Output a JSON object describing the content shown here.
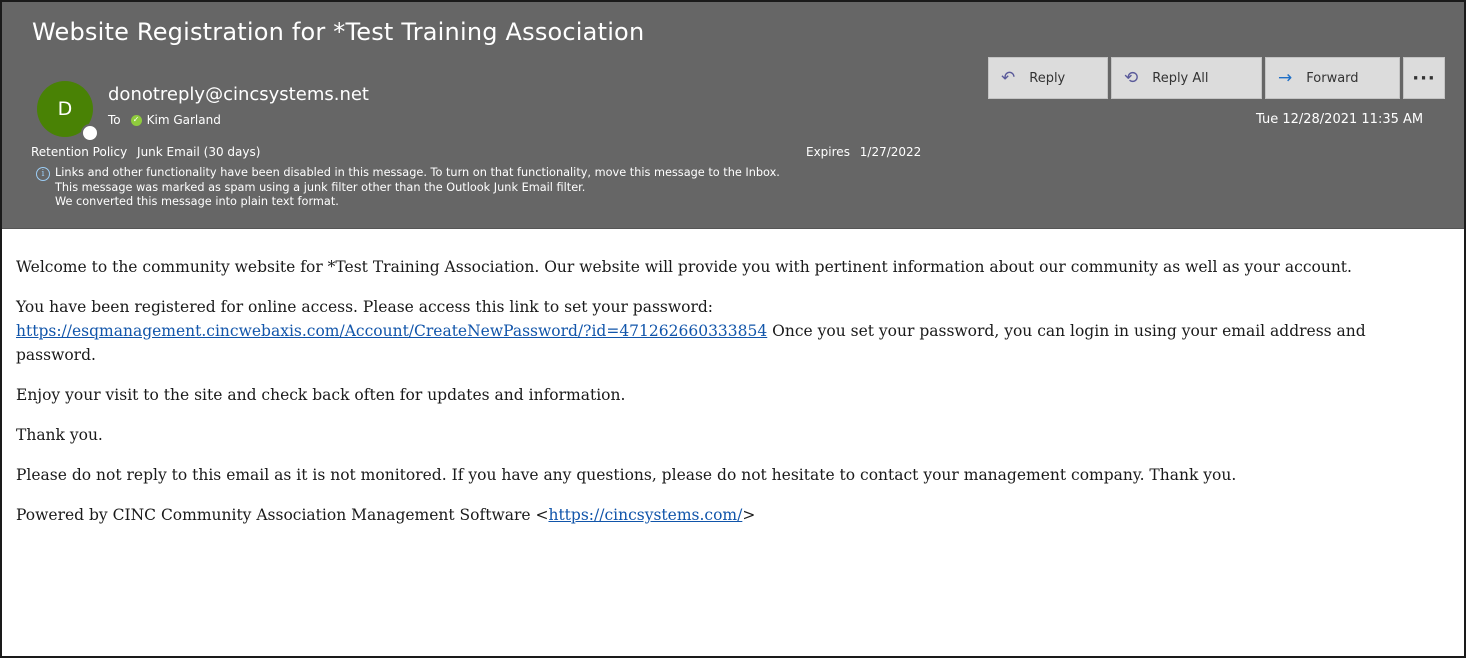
{
  "header": {
    "subject": "Website Registration for *Test Training Association",
    "avatar_initial": "D",
    "sender": "donotreply@cincsystems.net",
    "to_label": "To",
    "recipient": "Kim Garland",
    "retention_label": "Retention Policy",
    "retention_value": "Junk Email (30 days)",
    "expires_label": "Expires",
    "expires_value": "1/27/2022",
    "datetime": "Tue 12/28/2021 11:35 AM",
    "info_lines": [
      "Links and other functionality have been disabled in this message. To turn on that functionality, move this message to the Inbox.",
      "This message was marked as spam using a junk filter other than the Outlook Junk Email filter.",
      "We converted this message into plain text format."
    ],
    "avatar_color": "#498205",
    "header_bg": "#666666"
  },
  "actions": {
    "reply": "Reply",
    "reply_all": "Reply All",
    "forward": "Forward",
    "more": "···"
  },
  "body": {
    "p1": "Welcome to the community website for *Test Training Association. Our website will provide you with pertinent information about our community as well as your account.",
    "p2_text": "You have been registered for online access. Please access this link to set your password:",
    "p2_link": "https://esqmanagement.cincwebaxis.com/Account/CreateNewPassword/?id=471262660333854",
    "p2_after": " Once you set your password, you can login in using your email address and password.",
    "p3": "Enjoy your visit to the site and check back often for updates and information.",
    "p4": "Thank you.",
    "p5": "Please do not reply to this email as it is not monitored. If you have any questions, please do not hesitate to contact your management company. Thank you.",
    "p6_before": "Powered by CINC Community Association Management Software <",
    "p6_link": "https://cincsystems.com/",
    "p6_after": ">",
    "link_color": "#1155aa"
  }
}
